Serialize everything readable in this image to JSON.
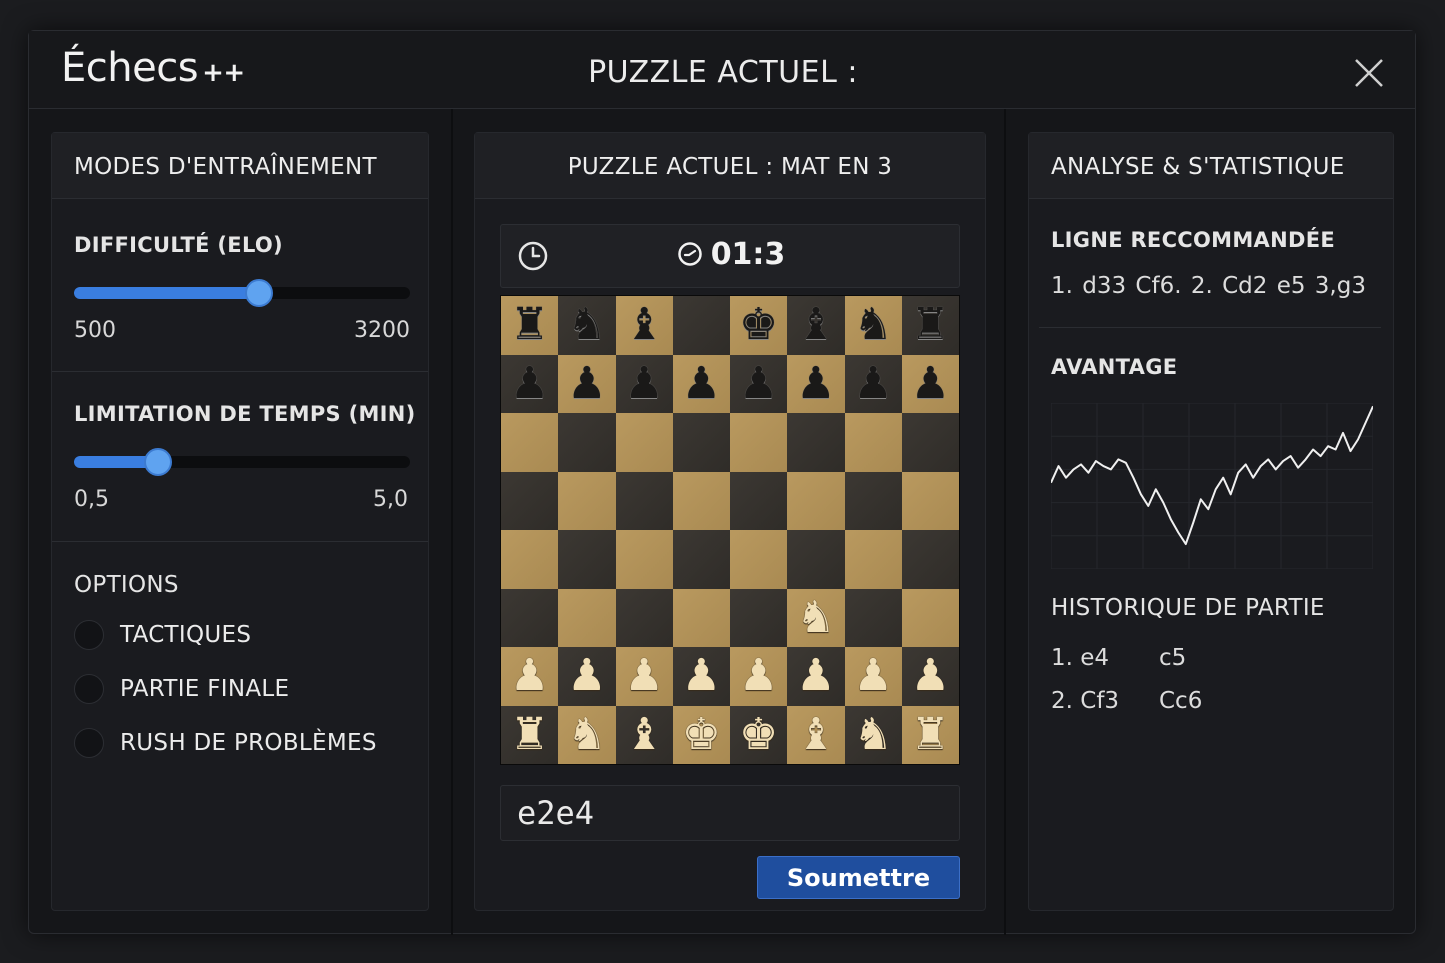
{
  "app": {
    "title": "Échecs",
    "title_suffix": "++",
    "window_title": "PUZZLE ACTUEL :"
  },
  "left_panel": {
    "header": "MODES D'ENTRAÎNEMENT",
    "difficulty": {
      "label": "DIFFICULTÉ (ELO)",
      "min_label": "500",
      "max_label": "3200",
      "level": 0.55
    },
    "time_limit": {
      "label": "LIMITATION DE TEMPS (MIN)",
      "min_label": "0,5",
      "max_label": "5,0",
      "level": 0.25
    },
    "options": {
      "label": "OPTIONS",
      "items": [
        {
          "label": "TACTIQUES",
          "checked": false
        },
        {
          "label": "PARTIE FINALE",
          "checked": false
        },
        {
          "label": "RUSH DE PROBLÈMES",
          "checked": false
        }
      ]
    }
  },
  "center_panel": {
    "header": "PUZZLE ACTUEL : MAT EN 3",
    "timer": "01:3",
    "board": [
      [
        "bR",
        "bN",
        "bB",
        "",
        "bK",
        "bB",
        "bN",
        "bR"
      ],
      [
        "bP",
        "bP",
        "bP",
        "bP",
        "bP",
        "bP",
        "bP",
        "bP"
      ],
      [
        "",
        "",
        "",
        "",
        "",
        "",
        "",
        ""
      ],
      [
        "",
        "",
        "",
        "",
        "",
        "",
        "",
        ""
      ],
      [
        "",
        "",
        "",
        "",
        "",
        "",
        "",
        ""
      ],
      [
        "",
        "",
        "",
        "",
        "",
        "wN",
        "",
        ""
      ],
      [
        "wP",
        "wP",
        "wP",
        "wP",
        "wP",
        "wP",
        "wP",
        "wP"
      ],
      [
        "wR",
        "wN",
        "wB",
        "wK",
        "wK",
        "wB",
        "wN",
        "wR"
      ]
    ],
    "move_input_value": "e2e4",
    "submit_label": "Soumettre"
  },
  "right_panel": {
    "header": "ANALYSE & S'TATISTIQUE",
    "recommended": {
      "label": "LIGNE RECCOMMANDÉE",
      "line": "1. d33  Cf6. 2. Cd2  e5  3,g3"
    },
    "advantage": {
      "label": "AVANTAGE",
      "chart_data": {
        "type": "line",
        "values": [
          0.52,
          0.62,
          0.55,
          0.6,
          0.63,
          0.58,
          0.65,
          0.62,
          0.6,
          0.66,
          0.64,
          0.55,
          0.45,
          0.38,
          0.48,
          0.4,
          0.3,
          0.22,
          0.15,
          0.28,
          0.42,
          0.36,
          0.48,
          0.55,
          0.45,
          0.58,
          0.63,
          0.55,
          0.62,
          0.66,
          0.6,
          0.65,
          0.68,
          0.61,
          0.66,
          0.72,
          0.68,
          0.74,
          0.72,
          0.82,
          0.71,
          0.78,
          0.88,
          0.98
        ],
        "grid": true,
        "xlabel": "",
        "ylabel": ""
      }
    },
    "history": {
      "label": "HISTORIQUE DE PARTIE",
      "rows": [
        {
          "white": "1. e4",
          "black": "c5"
        },
        {
          "white": "2. Cf3",
          "black": "Cc6"
        }
      ]
    }
  }
}
